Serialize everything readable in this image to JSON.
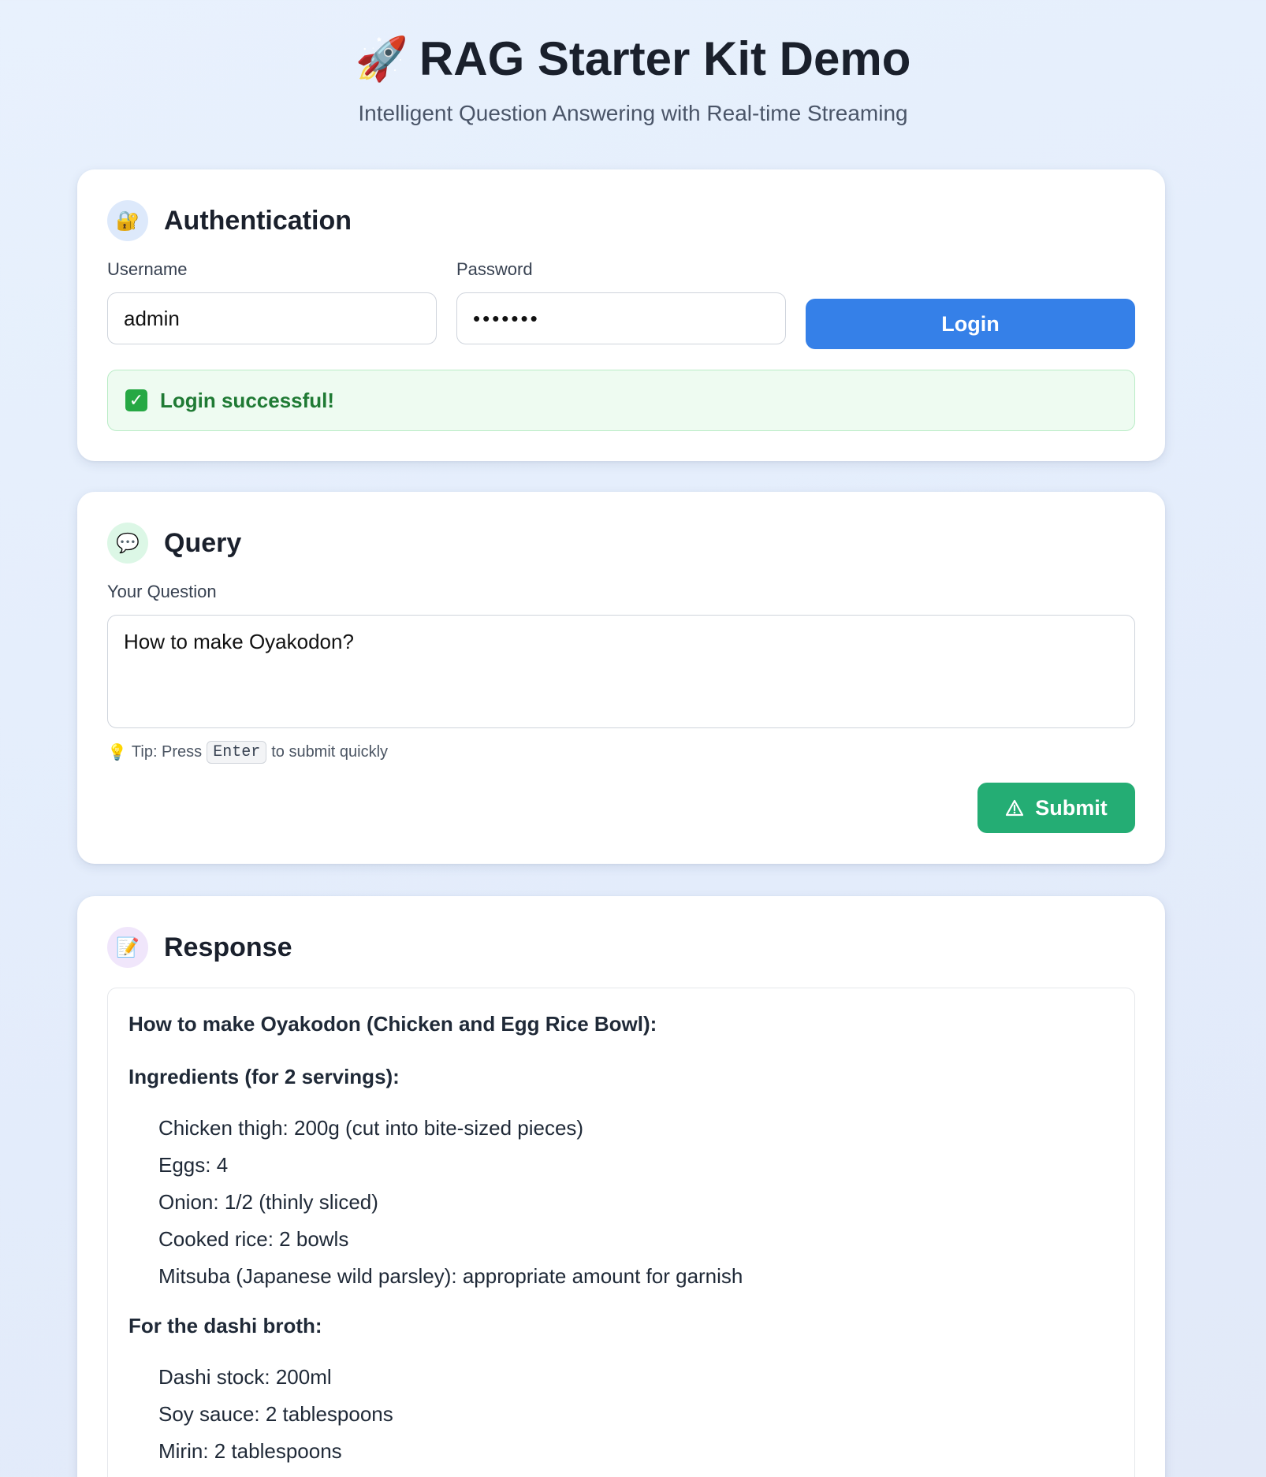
{
  "header": {
    "icon": "rocket-icon",
    "emoji": "🚀",
    "title": "RAG Starter Kit Demo",
    "subtitle": "Intelligent Question Answering with Real-time Streaming"
  },
  "auth": {
    "icon": "lock-key-icon",
    "emoji": "🔐",
    "title": "Authentication",
    "username_label": "Username",
    "username_value": "admin",
    "password_label": "Password",
    "password_value": "•••••••",
    "login_label": "Login",
    "success_icon": "check-mark-icon",
    "success_message": "Login successful!"
  },
  "query": {
    "icon": "speech-bubble-icon",
    "emoji": "💬",
    "title": "Query",
    "question_label": "Your Question",
    "question_value": "How to make Oyakodon?",
    "tip_icon": "lightbulb-icon",
    "tip_emoji": "💡",
    "tip_prefix": "Tip: Press",
    "tip_key": "Enter",
    "tip_suffix": "to submit quickly",
    "submit_icon": "warning-triangle-icon",
    "submit_label": "Submit"
  },
  "response": {
    "icon": "memo-icon",
    "emoji": "📝",
    "title": "Response",
    "heading": "How to make Oyakodon (Chicken and Egg Rice Bowl):",
    "ingredients_heading": "Ingredients (for 2 servings):",
    "ingredients": [
      "Chicken thigh: 200g (cut into bite-sized pieces)",
      "Eggs: 4",
      "Onion: 1/2 (thinly sliced)",
      "Cooked rice: 2 bowls",
      "Mitsuba (Japanese wild parsley): appropriate amount for garnish"
    ],
    "broth_heading": "For the dashi broth:",
    "broth": [
      "Dashi stock: 200ml",
      "Soy sauce: 2 tablespoons",
      "Mirin: 2 tablespoons"
    ]
  },
  "colors": {
    "primary": "#3580e8",
    "success": "#24ad74",
    "success_text": "#1f7a34"
  }
}
